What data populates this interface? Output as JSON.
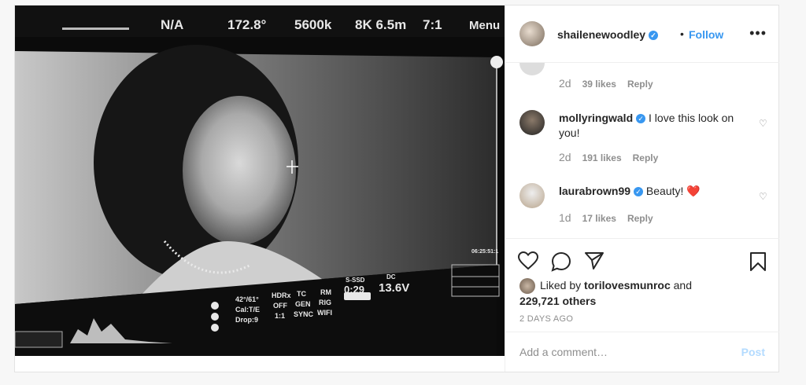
{
  "post": {
    "author": "shailenewoodley",
    "follow_label": "Follow",
    "separator": "•",
    "more_label": "•••"
  },
  "photo": {
    "hud_top": [
      "N/A",
      "172.8°",
      "5600k",
      "8K 6.5m",
      "7:1",
      "Menu"
    ],
    "hud_bottom": [
      "42°/61°",
      "Cal:T/E",
      "Drop:9",
      "HDRx",
      "OFF",
      "1:1",
      "TC",
      "GEN",
      "SYNC",
      "RM",
      "RIG",
      "WIFI",
      "S-SSD",
      "0:29",
      "DC",
      "13.6V"
    ],
    "timecode": "06:25:51:1"
  },
  "comments": [
    {
      "user": "",
      "text": "",
      "time": "2d",
      "likes": "39 likes",
      "reply": "Reply"
    },
    {
      "user": "mollyringwald",
      "text": "I love this look on you!",
      "time": "2d",
      "likes": "191 likes",
      "reply": "Reply"
    },
    {
      "user": "laurabrown99",
      "text": "Beauty! ❤️",
      "time": "1d",
      "likes": "17 likes",
      "reply": "Reply"
    }
  ],
  "likes": {
    "prefix": "Liked by",
    "user": "torilovesmunroc",
    "and": "and",
    "others": "229,721 others"
  },
  "timestamp": "2 DAYS AGO",
  "add_comment": {
    "placeholder": "Add a comment…",
    "post_label": "Post"
  },
  "colors": {
    "link_blue": "#3897f0",
    "muted": "#8e8e8e",
    "text": "#262626",
    "post_disabled": "#b3dbff"
  }
}
